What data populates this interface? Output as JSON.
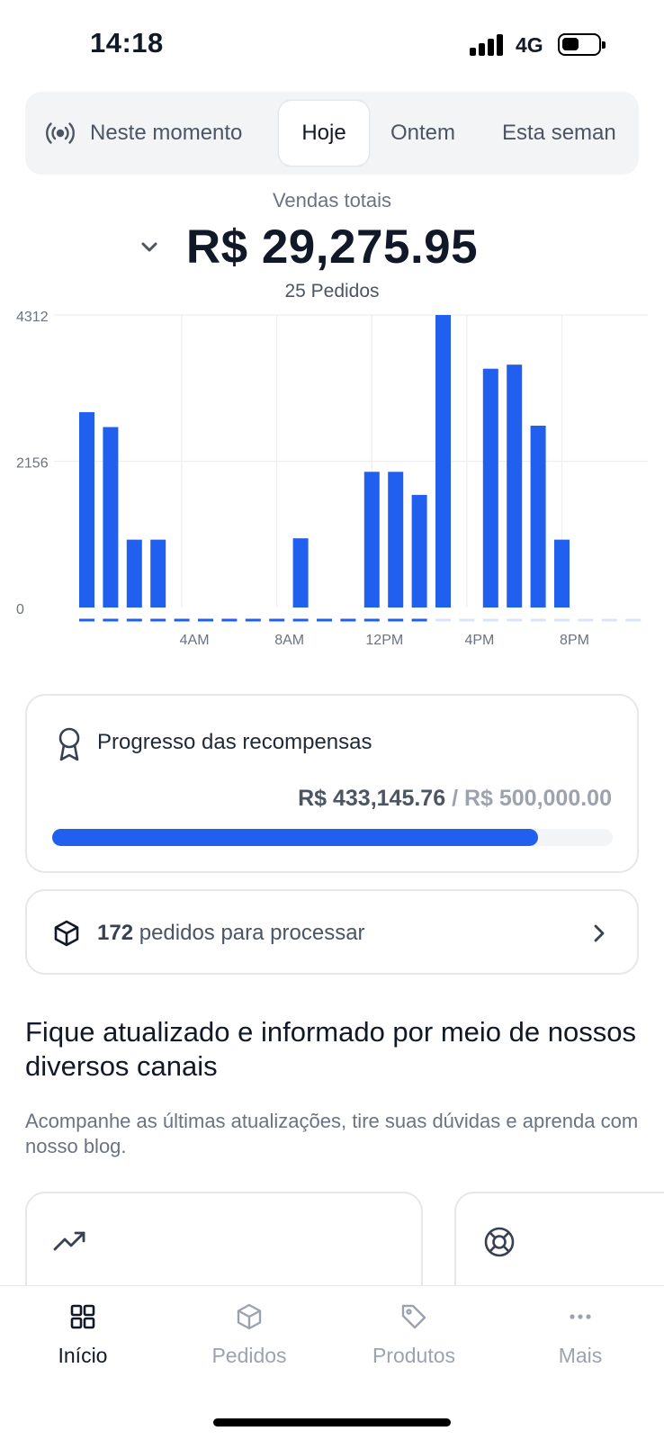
{
  "status_bar": {
    "time": "14:18",
    "network": "4G"
  },
  "period_tabs": [
    {
      "label": "Neste momento",
      "icon": "live-broadcast-icon"
    },
    {
      "label": "Hoje",
      "selected": true
    },
    {
      "label": "Ontem"
    },
    {
      "label": "Esta seman"
    }
  ],
  "summary": {
    "sales_label": "Vendas totais",
    "sales_value": "R$ 29,275.95",
    "orders_count": "25 Pedidos"
  },
  "chart_data": {
    "type": "bar",
    "y_ticks": [
      "4312",
      "2156",
      "0"
    ],
    "ylim": [
      0,
      4312
    ],
    "x_tick_labels": [
      "4AM",
      "8AM",
      "12PM",
      "4PM",
      "8PM"
    ],
    "x_tick_hours": [
      4,
      8,
      12,
      16,
      20
    ],
    "hours": [
      0,
      1,
      2,
      3,
      4,
      5,
      6,
      7,
      8,
      9,
      10,
      11,
      12,
      13,
      14,
      15,
      16,
      17,
      18,
      19,
      20,
      21,
      22,
      23
    ],
    "values": [
      2880,
      2660,
      1000,
      1000,
      0,
      0,
      0,
      0,
      0,
      1020,
      0,
      0,
      2000,
      2000,
      1660,
      4312,
      0,
      3520,
      3580,
      2680,
      1000,
      0,
      0,
      0
    ],
    "current_hour_index": 14,
    "grid": true,
    "bar_color": "#2160ee",
    "baseline_past_color": "#2160ee",
    "baseline_future_color": "#dbe4f7"
  },
  "rewards": {
    "title": "Progresso das recompensas",
    "current": "R$ 433,145.76",
    "separator": " / ",
    "goal": "R$ 500,000.00",
    "progress": 0.866,
    "accent": "#2160ee"
  },
  "orders_to_process": {
    "count": "172",
    "text": " pedidos para processar"
  },
  "info": {
    "heading": "Fique atualizado e informado por meio de nossos diversos canais",
    "description": "Acompanhe as últimas atualizações, tire suas dúvidas e aprenda com nosso blog."
  },
  "channels": [
    {
      "icon": "trending-up-icon"
    },
    {
      "icon": "lifebuoy-icon"
    }
  ],
  "bottom_nav": [
    {
      "label": "Início",
      "icon": "grid-icon",
      "active": true
    },
    {
      "label": "Pedidos",
      "icon": "box-icon"
    },
    {
      "label": "Produtos",
      "icon": "tag-icon"
    },
    {
      "label": "Mais",
      "icon": "more-icon"
    }
  ]
}
